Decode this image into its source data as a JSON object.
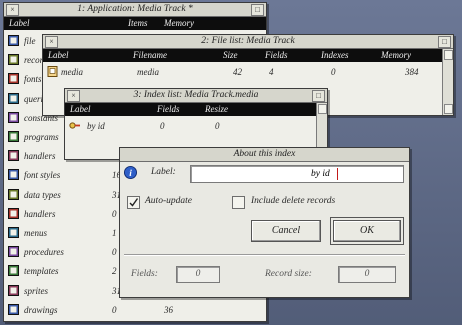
{
  "win1": {
    "title": "1: Application: Media Track *",
    "headers": {
      "label": "Label",
      "items": "Items",
      "memory": "Memory"
    },
    "rows": [
      {
        "label": "file",
        "items": "",
        "memory": ""
      },
      {
        "label": "records",
        "items": "",
        "memory": ""
      },
      {
        "label": "fonts",
        "items": "",
        "memory": ""
      },
      {
        "label": "queries",
        "items": "",
        "memory": ""
      },
      {
        "label": "constants",
        "items": "",
        "memory": ""
      },
      {
        "label": "programs",
        "items": "",
        "memory": ""
      },
      {
        "label": "handlers",
        "items": "",
        "memory": ""
      },
      {
        "label": "font styles",
        "items": "16",
        "memory": ""
      },
      {
        "label": "data types",
        "items": "31",
        "memory": ""
      },
      {
        "label": "handlers",
        "items": "0",
        "memory": ""
      },
      {
        "label": "menus",
        "items": "1",
        "memory": ""
      },
      {
        "label": "procedures",
        "items": "0",
        "memory": ""
      },
      {
        "label": "templates",
        "items": "2",
        "memory": ""
      },
      {
        "label": "sprites",
        "items": "31",
        "memory": ""
      },
      {
        "label": "drawings",
        "items": "0",
        "memory": "36"
      }
    ]
  },
  "win2": {
    "title": "2: File list: Media Track",
    "headers": {
      "label": "Label",
      "filename": "Filename",
      "size": "Size",
      "fields": "Fields",
      "indexes": "Indexes",
      "memory": "Memory"
    },
    "rows": [
      {
        "label": "media",
        "filename": "media",
        "size": "42",
        "fields": "4",
        "indexes": "0",
        "memory": "384"
      }
    ]
  },
  "win3": {
    "title": "3: Index list: Media Track.media",
    "headers": {
      "label": "Label",
      "fields": "Fields",
      "resize": "Resize"
    },
    "rows": [
      {
        "label": "by id",
        "fields": "0",
        "resize": "0"
      }
    ]
  },
  "dialog": {
    "title": "About this index",
    "label_caption": "Label:",
    "label_value": "by id",
    "auto_update_label": "Auto-update",
    "auto_update_checked": true,
    "include_deleted_label": "Include delete records",
    "include_deleted_checked": false,
    "cancel_label": "Cancel",
    "ok_label": "OK",
    "fields_caption": "Fields:",
    "fields_value": "0",
    "record_size_caption": "Record size:",
    "record_size_value": "0"
  },
  "colors": {
    "title_bar": "#d6d6cc",
    "header": "#0d0d0d",
    "window": "#efefe9",
    "info_icon": "#2f5fc8"
  }
}
